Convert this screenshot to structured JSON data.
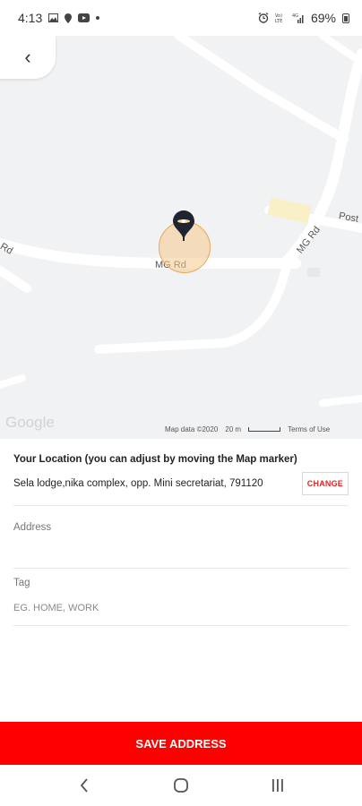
{
  "status_bar": {
    "time": "4:13",
    "battery_percent": "69%",
    "left_icons": [
      "gallery-icon",
      "location-icon",
      "youtube-icon",
      "dot-icon"
    ],
    "right_icons": [
      "alarm-icon",
      "volte-icon",
      "signal-icon",
      "battery-icon"
    ]
  },
  "map": {
    "road_labels": {
      "mg_rd_main": "MG Rd",
      "mg_rd_vertical": "MG Rd",
      "rd_left": "Rd",
      "post": "Post"
    },
    "google_logo": "Google",
    "map_data": "Map data ©2020",
    "scale": "20 m",
    "terms": "Terms of Use",
    "colors": {
      "background": "#f1f2f4",
      "road": "#ffffff",
      "marker_fill": "#f5c88c",
      "marker_pin": "#1f2530"
    }
  },
  "location": {
    "title": "Your Location (you can adjust by moving the Map marker)",
    "value": "Sela lodge,nika complex, opp. Mini secretariat, 791120",
    "change_label": "CHANGE"
  },
  "address_field": {
    "label": "Address",
    "value": "",
    "placeholder": ""
  },
  "tag_field": {
    "label": "Tag",
    "value": "",
    "placeholder": "EG. HOME, WORK"
  },
  "save_button": {
    "label": "SAVE ADDRESS",
    "color": "#ff0000"
  },
  "nav_bar": {
    "items": [
      "back-icon",
      "home-icon",
      "recents-icon"
    ]
  }
}
